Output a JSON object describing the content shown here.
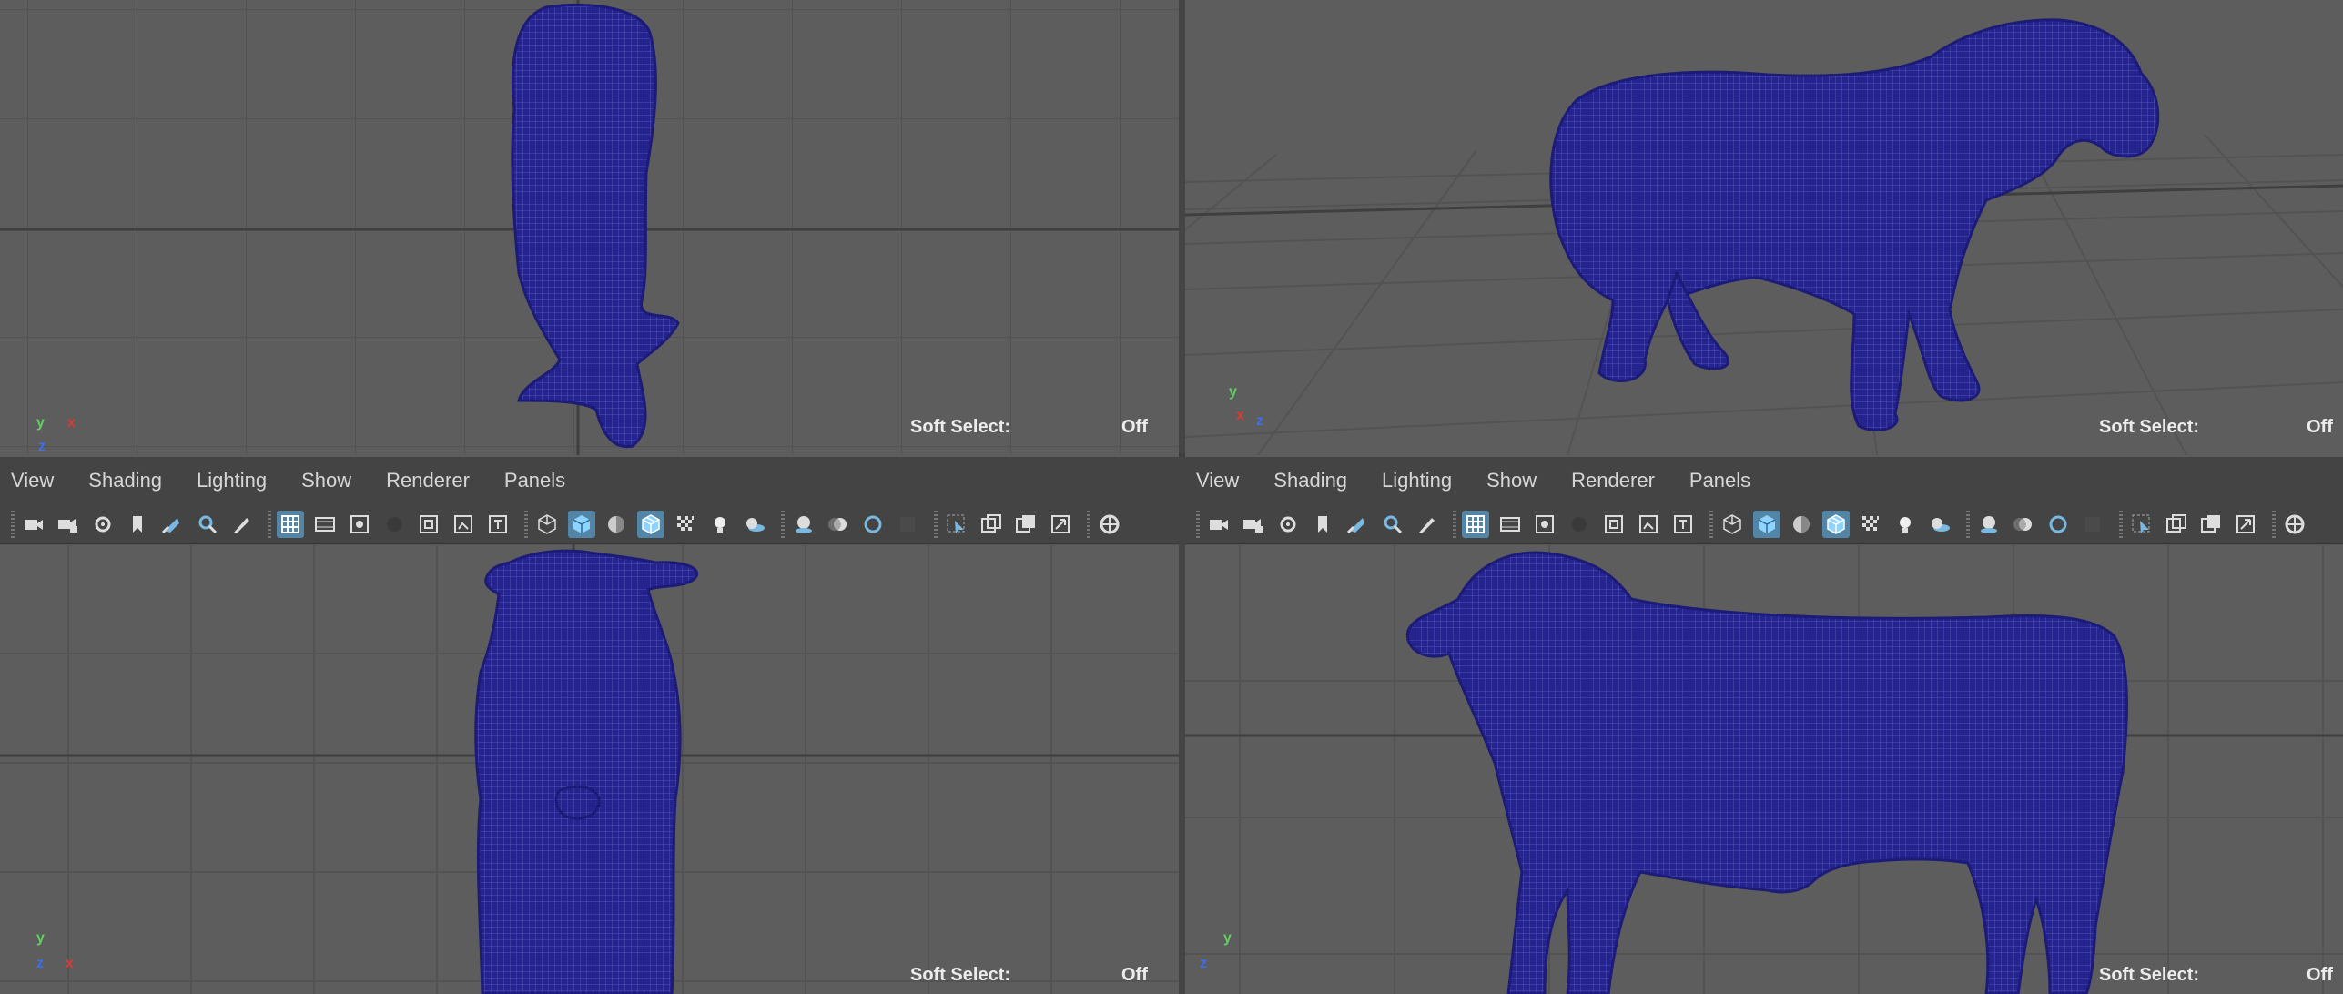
{
  "panels": {
    "top_left": {
      "soft_select": {
        "label": "Soft Select:",
        "value": "Off"
      }
    },
    "top_right": {
      "soft_select": {
        "label": "Soft Select:",
        "value": "Off"
      }
    },
    "bottom_left": {
      "menu": [
        "View",
        "Shading",
        "Lighting",
        "Show",
        "Renderer",
        "Panels"
      ],
      "soft_select": {
        "label": "Soft Select:",
        "value": "Off"
      }
    },
    "bottom_right": {
      "menu": [
        "View",
        "Shading",
        "Lighting",
        "Show",
        "Renderer",
        "Panels"
      ],
      "soft_select": {
        "label": "Soft Select:",
        "value": "Off"
      }
    }
  },
  "axis_labels": {
    "x": "x",
    "y": "y",
    "z": "z"
  },
  "toolbar_icons": [
    "camera-select-icon",
    "camera-lock-icon",
    "camera-attributes-icon",
    "bookmark-icon",
    "image-plane-icon",
    "grease-pencil-icon",
    "2d-pan-zoom-icon",
    "grid-icon",
    "film-gate-icon",
    "resolution-gate-icon",
    "gate-mask-icon",
    "field-chart-icon",
    "safe-action-icon",
    "safe-title-icon",
    "wireframe-icon",
    "smooth-shade-icon",
    "use-default-material-icon",
    "wireframe-on-shaded-icon",
    "textured-icon",
    "lighting-icon",
    "shadows-icon",
    "screen-space-ao-icon",
    "motion-blur-icon",
    "anti-aliasing-icon",
    "depth-of-field-icon",
    "isolate-select-icon",
    "xray-icon",
    "xray-joints-icon",
    "xray-components-icon",
    "exposure-icon"
  ],
  "colors": {
    "viewport_bg": "#5d5d5d",
    "grid_line": "#535353",
    "mesh_fill": "#24238f",
    "mesh_wire": "#8f93e0",
    "active_button": "#5285a6",
    "axis_x": "#e0372f",
    "axis_y": "#5fd35f",
    "axis_z": "#3b6ef0"
  }
}
